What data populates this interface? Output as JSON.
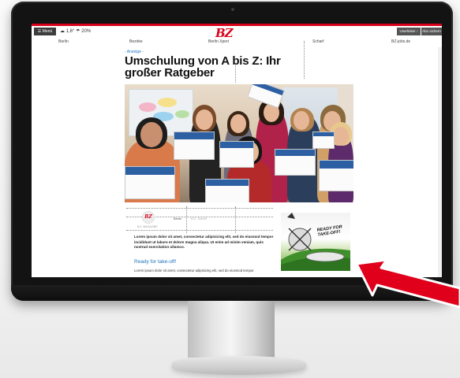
{
  "nav": {
    "menu_label": "☰ Menü",
    "weather": "☁ 1,6° ☂ 20%",
    "logo": "BZ",
    "btn_subscribe": "Userlinker ›",
    "btn_secure": "Abo sichern ›"
  },
  "sections": [
    "Berlin",
    "Bezirke",
    "Berlin Xpert",
    "Scharf",
    "BZ-jobs.de"
  ],
  "article": {
    "kicker": "- Anzeige -",
    "title": "Umschulung von A bis Z: Ihr großer Ratgeber",
    "badge_logo": "BZ",
    "badge_caption": "B.Z. MAGAZINE",
    "tags": [
      "Berlin",
      "B.Z. Schrift"
    ],
    "lead": "Lorem ipsum dolor sit amet, consectetur adipisicing elit, sed do eiusmod tempor incididunt ut labore et dolore magna aliqua. Ut enim ad minim veniam, quis nostrud exercitation ullamco.",
    "link": "Ready for take-off!",
    "body": "Lorem ipsum dolor sit amet, consectetur adipisicing elit, sed do eiusmod tempor"
  },
  "ad": {
    "text": "READY FOR TAKE-OFF!"
  },
  "colors": {
    "brand_red": "#d8001a",
    "link_blue": "#1e73be",
    "arrow_red": "#e0001b"
  },
  "icons": [
    "menu-icon",
    "cloud-icon",
    "umbrella-icon",
    "red-arrow-pointer"
  ]
}
